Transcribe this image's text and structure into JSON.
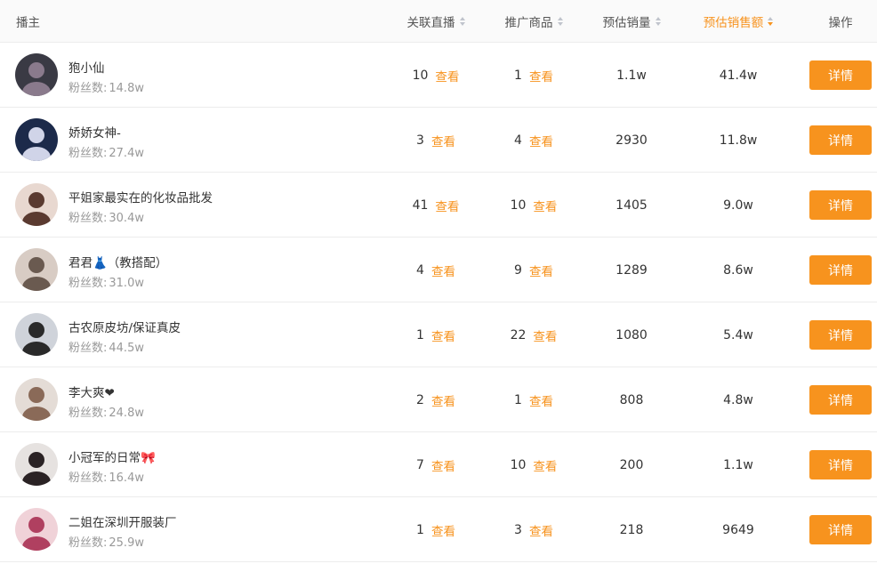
{
  "header": {
    "anchor": "播主",
    "live": "关联直播",
    "goods": "推广商品",
    "sales": "预估销量",
    "amount": "预估销售额",
    "ops": "操作",
    "active_sort_color": "#f7931e"
  },
  "fans_label": "粉丝数:",
  "view_label": "查看",
  "detail_label": "详情",
  "rows": [
    {
      "name": "狍小仙",
      "fans": "14.8w",
      "live": "10",
      "goods": "1",
      "sales": "1.1w",
      "amount": "41.4w"
    },
    {
      "name": "娇娇女神-",
      "fans": "27.4w",
      "live": "3",
      "goods": "4",
      "sales": "2930",
      "amount": "11.8w"
    },
    {
      "name": "平姐家最实在的化妆品批发",
      "fans": "30.4w",
      "live": "41",
      "goods": "10",
      "sales": "1405",
      "amount": "9.0w"
    },
    {
      "name": "君君👗（教搭配）",
      "fans": "31.0w",
      "live": "4",
      "goods": "9",
      "sales": "1289",
      "amount": "8.6w"
    },
    {
      "name": "古农原皮坊/保证真皮",
      "fans": "44.5w",
      "live": "1",
      "goods": "22",
      "sales": "1080",
      "amount": "5.4w"
    },
    {
      "name": "李大爽❤",
      "fans": "24.8w",
      "live": "2",
      "goods": "1",
      "sales": "808",
      "amount": "4.8w"
    },
    {
      "name": "小冠军的日常🎀",
      "fans": "16.4w",
      "live": "7",
      "goods": "10",
      "sales": "200",
      "amount": "1.1w"
    },
    {
      "name": "二姐在深圳开服装厂",
      "fans": "25.9w",
      "live": "1",
      "goods": "3",
      "sales": "218",
      "amount": "9649"
    }
  ]
}
